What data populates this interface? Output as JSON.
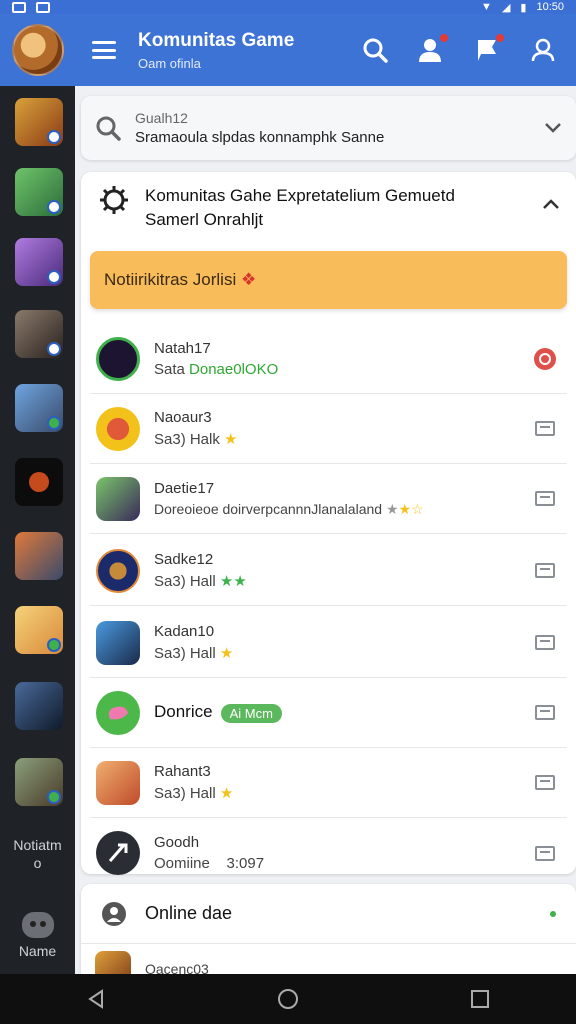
{
  "status": {
    "time": "10:50"
  },
  "appbar": {
    "title": "Komunitas Game",
    "subtitle": "Oam ofinla",
    "icons": [
      "search-icon",
      "add-person-icon",
      "flag-icon",
      "user-icon"
    ]
  },
  "sidebar": {
    "label1": "Notiatm",
    "label2": "o",
    "bottom_label": "Name"
  },
  "search": {
    "hint": "Gualh12",
    "query": "Sramaoula slpdas konnamphk Sanne"
  },
  "panel": {
    "title_line1": "Komunitas Gahe Expretatelium Gemuetd",
    "title_line2": "Samerl Onrahljt",
    "notify_label": "Notiirikitras Jorlisi"
  },
  "rows": [
    {
      "name": "Natah17",
      "sub": "Sata",
      "sub_green": "Donae0lOKO"
    },
    {
      "name": "Naoaur3",
      "sub": "Sa3) Halk"
    },
    {
      "name": "Daetie17",
      "sub": "Doreoieoe doirverpcannnJlanalaland"
    },
    {
      "name": "Sadke12",
      "sub": "Sa3) Hall"
    },
    {
      "name": "Kadan10",
      "sub": "Sa3) Hall"
    },
    {
      "name": "Donrice",
      "pill": "Ai Mcm"
    },
    {
      "name": "Rahant3",
      "sub": "Sa3) Hall"
    },
    {
      "name": "Goodh",
      "sub": "Oomiine",
      "extra": "3:097"
    }
  ],
  "online": {
    "label": "Online dae",
    "first_item": "Oacenc03"
  },
  "colors": {
    "accent": "#3e73d6",
    "notify": "#f9bc5a",
    "sidebar": "#1f2226"
  }
}
